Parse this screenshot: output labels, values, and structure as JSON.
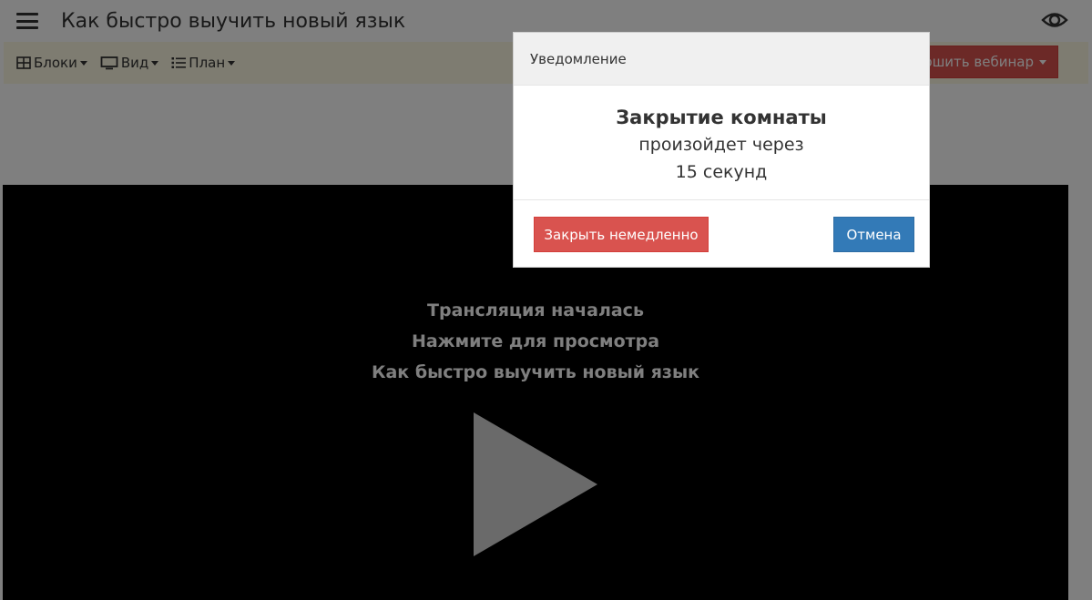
{
  "header": {
    "menu_icon": "hamburger-icon",
    "title": "Как быстро выучить новый язык",
    "view_icon": "eye-icon"
  },
  "toolbar": {
    "items": [
      {
        "label": "Блоки",
        "icon": "grid-icon"
      },
      {
        "label": "Вид",
        "icon": "monitor-icon"
      },
      {
        "label": "План",
        "icon": "list-icon"
      }
    ],
    "finish_label": "ршить вебинар"
  },
  "video": {
    "lines": [
      "Трансляция началась",
      "Нажмите для просмотра",
      "Как быстро выучить новый язык"
    ],
    "play_icon": "play-icon"
  },
  "modal": {
    "title": "Уведомление",
    "headline": "Закрытие комнаты",
    "line1": "произойдет через",
    "line2": "15 секунд",
    "close_now_label": "Закрыть немедленно",
    "cancel_label": "Отмена"
  },
  "colors": {
    "toolbar_bg": "#fcf8e3",
    "danger": "#d9534f",
    "primary": "#337ab7",
    "video_bg": "#000000"
  }
}
